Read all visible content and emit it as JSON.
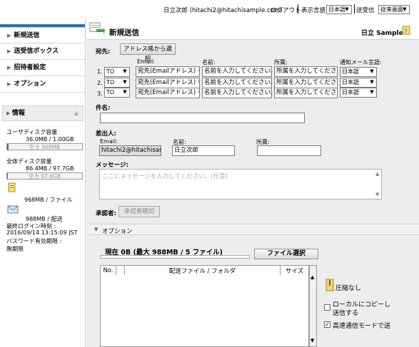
{
  "topbar": {
    "user": "日立次郎 (hitachi2@hitachisample.com)",
    "logout": "ログアウト",
    "display_lang_label": "表示言語",
    "display_lang_value": "日本語",
    "mode_label": "送受信",
    "mode_value": "従来画面"
  },
  "sidebar": {
    "items": [
      {
        "label": "新規送信"
      },
      {
        "label": "送受信ボックス"
      },
      {
        "label": "招待者設定"
      },
      {
        "label": "オプション"
      }
    ],
    "info": {
      "header": "情報",
      "user_disk_label": "ユーザディスク容量",
      "user_disk_value": "36.0MB / 1.00GB",
      "user_disk_free": "空き 968MB",
      "total_disk_label": "全体ディスク容量",
      "total_disk_value": "86.4MB / 97.7GB",
      "total_disk_free": "空き 97.6GB",
      "file_limit": "968MB / ファイル",
      "delivery_limit": "988MB / 配送",
      "last_login_label": "最終ログイン時刻 :",
      "last_login_value": "2016/09/14 13:15:09 JST",
      "pw_expiry_label": "パスワード有効期限 :",
      "pw_expiry_value": "無期限"
    }
  },
  "main": {
    "title": "新規送信",
    "brand": "日立 Sample",
    "recipients_label": "宛先:",
    "address_book_button": "アドレス帳から選択",
    "col_email": "Email:",
    "col_name": "名前:",
    "col_org": "所属:",
    "col_lang": "通知メール言語:",
    "recipients": [
      {
        "num": "1.",
        "type": "TO",
        "email_ph": "宛先(Emailアドレス) を.",
        "name_ph": "名前を入力してください。",
        "org_ph": "所属を入力してください。",
        "lang": "日本語"
      },
      {
        "num": "2.",
        "type": "TO",
        "email_ph": "宛先(Emailアドレス) を.",
        "name_ph": "名前を入力してください。",
        "org_ph": "所属を入力してください。",
        "lang": "日本語"
      },
      {
        "num": "3.",
        "type": "TO",
        "email_ph": "宛先(Emailアドレス) を.",
        "name_ph": "名前を入力してください。",
        "org_ph": "所属を入力してください。",
        "lang": "日本語"
      }
    ],
    "subject_label": "件名:",
    "sender_label": "差出人:",
    "sender_email_label": "Email:",
    "sender_email": "hitachi2@hitachisamp",
    "sender_name_label": "名前:",
    "sender_name": "日立次郎",
    "sender_org_label": "所属:",
    "message_label": "メッセージ:",
    "message_ph": "ここにメッセージを入力してください。(任意)",
    "approver_label": "承認者:",
    "approver_button": "承認者確認",
    "options_label": "オプション",
    "files_status": "現在 0B (最大 988MB / 5 ファイル)",
    "file_select_button": "ファイル選択",
    "files_columns": [
      "No.",
      "配送ファイル / フォルダ",
      "サイズ"
    ],
    "compression": "圧縮なし",
    "local_copy": "ローカルにコピーして送信する",
    "local_copy_l1": "ローカルにコピーし",
    "local_copy_l2": "送信する",
    "fast_mode": "高速通信モードで送"
  }
}
